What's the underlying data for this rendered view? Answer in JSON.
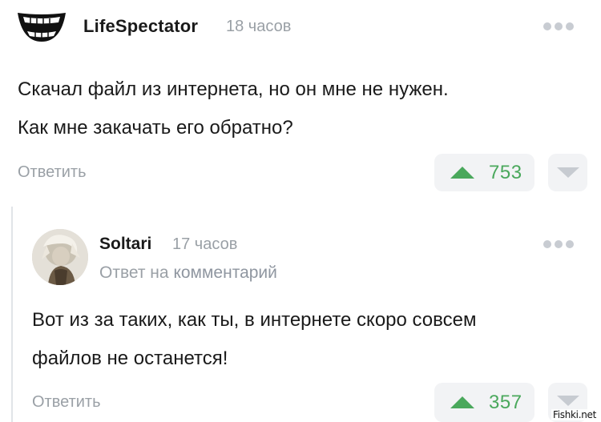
{
  "main_comment": {
    "author": "LifeSpectator",
    "time": "18 часов",
    "avatar_icon": "grin-smile-icon",
    "text_line1": "Скачал файл из интернета, но он мне не нужен.",
    "text_line2": "Как мне закачать его обратно?",
    "reply_label": "Ответить",
    "rating": "753"
  },
  "reply_comment": {
    "author": "Soltari",
    "time": "17 часов",
    "reply_prefix": "Ответ на",
    "reply_link": "комментарий",
    "text_line1": "Вот из за таких, как ты, в интернете скоро совсем",
    "text_line2": "файлов не останется!",
    "reply_label": "Ответить",
    "rating": "357"
  },
  "colors": {
    "upvote": "#4aa85c",
    "muted_text": "#9aa0a6",
    "vote_bg": "#f2f3f5"
  },
  "watermark": "Fishki.net"
}
